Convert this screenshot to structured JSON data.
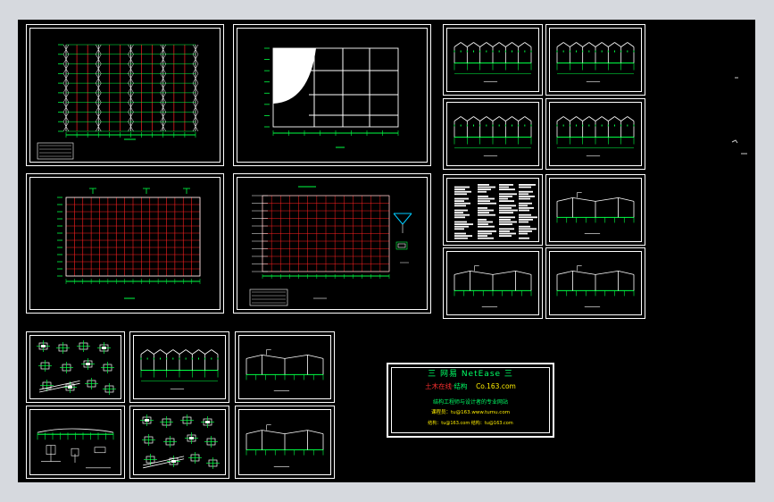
{
  "viewer": {
    "background": "#d6d9de",
    "canvas_color": "#000000",
    "frame_color": "#ffffff",
    "grid_colors": {
      "green": "#00ff44",
      "red": "#ff2020",
      "white": "#ffffff"
    }
  },
  "sheets": [
    {
      "id": "sheet-1",
      "kind": "truss-plan"
    },
    {
      "id": "sheet-2",
      "kind": "floor-plan"
    },
    {
      "id": "sheet-3",
      "kind": "elevation"
    },
    {
      "id": "sheet-4",
      "kind": "elevation"
    },
    {
      "id": "sheet-5",
      "kind": "red-grid-plan"
    },
    {
      "id": "sheet-6",
      "kind": "red-grid-plan-detail"
    },
    {
      "id": "sheet-7",
      "kind": "elevation"
    },
    {
      "id": "sheet-8",
      "kind": "elevation"
    },
    {
      "id": "sheet-9",
      "kind": "notes"
    },
    {
      "id": "sheet-10",
      "kind": "section"
    },
    {
      "id": "sheet-11",
      "kind": "section"
    },
    {
      "id": "sheet-12",
      "kind": "section"
    },
    {
      "id": "sheet-13",
      "kind": "details"
    },
    {
      "id": "sheet-14",
      "kind": "elevation"
    },
    {
      "id": "sheet-15",
      "kind": "section"
    },
    {
      "id": "sheet-16",
      "kind": "ground-elevation"
    },
    {
      "id": "sheet-17",
      "kind": "details"
    },
    {
      "id": "sheet-18",
      "kind": "section"
    }
  ],
  "stamp": {
    "title": "三 网易 NetEase 三",
    "row2_red": "土木在线·",
    "row2_green": "结构",
    "row2_yellow": "Co.163.com",
    "line3": "结构工程师与设计者的专业网站",
    "line4": "课程员：tu@163.www.tumu.com",
    "line5": "结构：tu@163.com  结构：tu@163.com"
  }
}
